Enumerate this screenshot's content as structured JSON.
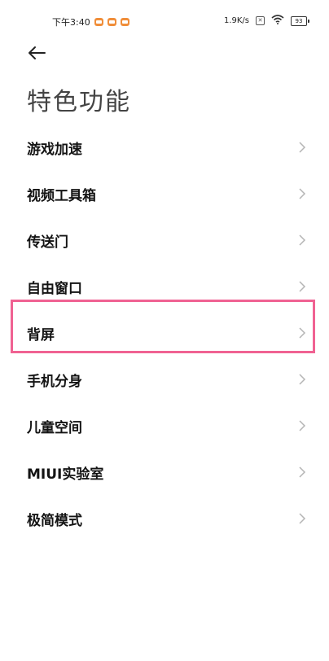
{
  "status_bar": {
    "time": "下午3:40",
    "network_speed": "1.9K/s",
    "sim_icon_text": "✕",
    "battery_level": "93",
    "notification_color": "#f08e3a"
  },
  "header": {
    "title": "特色功能"
  },
  "menu": {
    "items": [
      {
        "label": "游戏加速"
      },
      {
        "label": "视频工具箱"
      },
      {
        "label": "传送门"
      },
      {
        "label": "自由窗口"
      },
      {
        "label": "背屏",
        "highlighted": true
      },
      {
        "label": "手机分身"
      },
      {
        "label": "儿童空间"
      },
      {
        "label": "MIUI实验室"
      },
      {
        "label": "极简模式"
      }
    ]
  },
  "highlight_color": "#f06292"
}
